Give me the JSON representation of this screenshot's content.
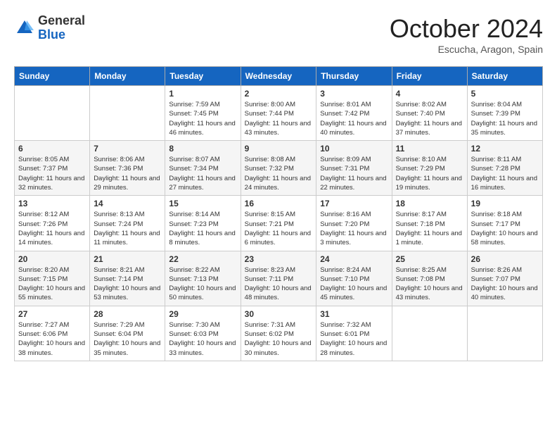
{
  "logo": {
    "general": "General",
    "blue": "Blue"
  },
  "title": "October 2024",
  "location": "Escucha, Aragon, Spain",
  "days_of_week": [
    "Sunday",
    "Monday",
    "Tuesday",
    "Wednesday",
    "Thursday",
    "Friday",
    "Saturday"
  ],
  "weeks": [
    [
      {
        "day": "",
        "info": ""
      },
      {
        "day": "",
        "info": ""
      },
      {
        "day": "1",
        "info": "Sunrise: 7:59 AM\nSunset: 7:45 PM\nDaylight: 11 hours and 46 minutes."
      },
      {
        "day": "2",
        "info": "Sunrise: 8:00 AM\nSunset: 7:44 PM\nDaylight: 11 hours and 43 minutes."
      },
      {
        "day": "3",
        "info": "Sunrise: 8:01 AM\nSunset: 7:42 PM\nDaylight: 11 hours and 40 minutes."
      },
      {
        "day": "4",
        "info": "Sunrise: 8:02 AM\nSunset: 7:40 PM\nDaylight: 11 hours and 37 minutes."
      },
      {
        "day": "5",
        "info": "Sunrise: 8:04 AM\nSunset: 7:39 PM\nDaylight: 11 hours and 35 minutes."
      }
    ],
    [
      {
        "day": "6",
        "info": "Sunrise: 8:05 AM\nSunset: 7:37 PM\nDaylight: 11 hours and 32 minutes."
      },
      {
        "day": "7",
        "info": "Sunrise: 8:06 AM\nSunset: 7:36 PM\nDaylight: 11 hours and 29 minutes."
      },
      {
        "day": "8",
        "info": "Sunrise: 8:07 AM\nSunset: 7:34 PM\nDaylight: 11 hours and 27 minutes."
      },
      {
        "day": "9",
        "info": "Sunrise: 8:08 AM\nSunset: 7:32 PM\nDaylight: 11 hours and 24 minutes."
      },
      {
        "day": "10",
        "info": "Sunrise: 8:09 AM\nSunset: 7:31 PM\nDaylight: 11 hours and 22 minutes."
      },
      {
        "day": "11",
        "info": "Sunrise: 8:10 AM\nSunset: 7:29 PM\nDaylight: 11 hours and 19 minutes."
      },
      {
        "day": "12",
        "info": "Sunrise: 8:11 AM\nSunset: 7:28 PM\nDaylight: 11 hours and 16 minutes."
      }
    ],
    [
      {
        "day": "13",
        "info": "Sunrise: 8:12 AM\nSunset: 7:26 PM\nDaylight: 11 hours and 14 minutes."
      },
      {
        "day": "14",
        "info": "Sunrise: 8:13 AM\nSunset: 7:24 PM\nDaylight: 11 hours and 11 minutes."
      },
      {
        "day": "15",
        "info": "Sunrise: 8:14 AM\nSunset: 7:23 PM\nDaylight: 11 hours and 8 minutes."
      },
      {
        "day": "16",
        "info": "Sunrise: 8:15 AM\nSunset: 7:21 PM\nDaylight: 11 hours and 6 minutes."
      },
      {
        "day": "17",
        "info": "Sunrise: 8:16 AM\nSunset: 7:20 PM\nDaylight: 11 hours and 3 minutes."
      },
      {
        "day": "18",
        "info": "Sunrise: 8:17 AM\nSunset: 7:18 PM\nDaylight: 11 hours and 1 minute."
      },
      {
        "day": "19",
        "info": "Sunrise: 8:18 AM\nSunset: 7:17 PM\nDaylight: 10 hours and 58 minutes."
      }
    ],
    [
      {
        "day": "20",
        "info": "Sunrise: 8:20 AM\nSunset: 7:15 PM\nDaylight: 10 hours and 55 minutes."
      },
      {
        "day": "21",
        "info": "Sunrise: 8:21 AM\nSunset: 7:14 PM\nDaylight: 10 hours and 53 minutes."
      },
      {
        "day": "22",
        "info": "Sunrise: 8:22 AM\nSunset: 7:13 PM\nDaylight: 10 hours and 50 minutes."
      },
      {
        "day": "23",
        "info": "Sunrise: 8:23 AM\nSunset: 7:11 PM\nDaylight: 10 hours and 48 minutes."
      },
      {
        "day": "24",
        "info": "Sunrise: 8:24 AM\nSunset: 7:10 PM\nDaylight: 10 hours and 45 minutes."
      },
      {
        "day": "25",
        "info": "Sunrise: 8:25 AM\nSunset: 7:08 PM\nDaylight: 10 hours and 43 minutes."
      },
      {
        "day": "26",
        "info": "Sunrise: 8:26 AM\nSunset: 7:07 PM\nDaylight: 10 hours and 40 minutes."
      }
    ],
    [
      {
        "day": "27",
        "info": "Sunrise: 7:27 AM\nSunset: 6:06 PM\nDaylight: 10 hours and 38 minutes."
      },
      {
        "day": "28",
        "info": "Sunrise: 7:29 AM\nSunset: 6:04 PM\nDaylight: 10 hours and 35 minutes."
      },
      {
        "day": "29",
        "info": "Sunrise: 7:30 AM\nSunset: 6:03 PM\nDaylight: 10 hours and 33 minutes."
      },
      {
        "day": "30",
        "info": "Sunrise: 7:31 AM\nSunset: 6:02 PM\nDaylight: 10 hours and 30 minutes."
      },
      {
        "day": "31",
        "info": "Sunrise: 7:32 AM\nSunset: 6:01 PM\nDaylight: 10 hours and 28 minutes."
      },
      {
        "day": "",
        "info": ""
      },
      {
        "day": "",
        "info": ""
      }
    ]
  ]
}
